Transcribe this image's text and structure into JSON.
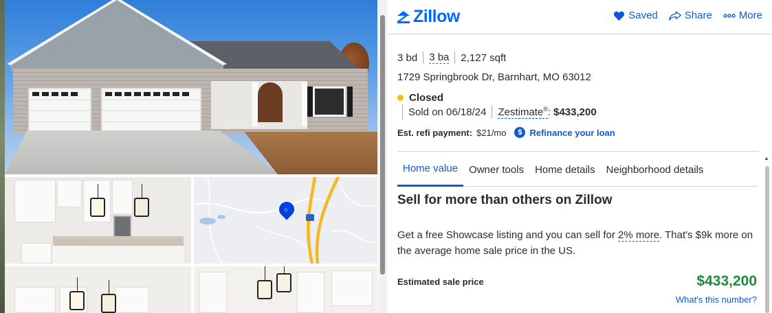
{
  "header": {
    "logo_text": "Zillow",
    "actions": [
      {
        "label": "Saved",
        "icon": "heart-icon"
      },
      {
        "label": "Share",
        "icon": "share-icon"
      },
      {
        "label": "More",
        "icon": "more-dots-icon"
      }
    ]
  },
  "facts": {
    "beds": "3 bd",
    "baths": "3 ba",
    "sqft": "2,127 sqft"
  },
  "address": "1729 Springbrook Dr, Barnhart, MO 63012",
  "status": {
    "label": "Closed",
    "sold_on": "Sold on 06/18/24",
    "zestimate_label": "Zestimate",
    "zestimate_sup": "®",
    "zestimate_sep": ":",
    "zestimate_value": "$433,200"
  },
  "refi": {
    "label": "Est. refi payment:",
    "value": "$21/mo",
    "icon_glyph": "$",
    "link": "Refinance your loan"
  },
  "tabs": [
    {
      "label": "Home value",
      "active": true
    },
    {
      "label": "Owner tools",
      "active": false
    },
    {
      "label": "Home details",
      "active": false
    },
    {
      "label": "Neighborhood details",
      "active": false
    }
  ],
  "sell": {
    "heading": "Sell for more than others on Zillow",
    "para_before": "Get a free Showcase listing and you can sell for ",
    "para_link": "2% more",
    "para_after": ". That's $9k more on the average home sale price in the US."
  },
  "estimate": {
    "label": "Estimated sale price",
    "value": "$433,200",
    "link": "What's this number?"
  },
  "map": {
    "highway_shield": "55"
  },
  "colors": {
    "brand": "#006aff",
    "link": "#0d5ad8",
    "status_dot": "#f5c00d",
    "price_green": "#1e8a3a"
  }
}
